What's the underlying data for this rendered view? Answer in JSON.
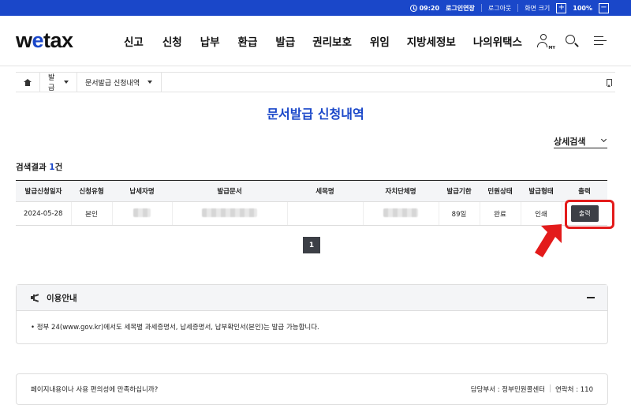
{
  "topbar": {
    "timer": "09:20",
    "extend_label": "로그인연장",
    "logout_label": "로그아웃",
    "screen_size_label": "화면 크기",
    "zoom_in": "+",
    "zoom": "100%",
    "zoom_out": "−"
  },
  "header": {
    "logo_w": "w",
    "logo_e": "e",
    "logo_rest": "tax",
    "nav": [
      "신고",
      "신청",
      "납부",
      "환급",
      "발급",
      "권리보호",
      "위임",
      "지방세정보",
      "나의위택스"
    ],
    "my_badge": "MY"
  },
  "breadcrumb": {
    "level1": "발급",
    "level2": "문서발급 신청내역"
  },
  "page_title": "문서발급 신청내역",
  "detail_search_label": "상세검색",
  "result": {
    "prefix": "검색결과 ",
    "count": "1",
    "suffix": "건"
  },
  "table": {
    "headers": [
      "발급신청일자",
      "신청유형",
      "납세자명",
      "발급문서",
      "세목명",
      "자치단체명",
      "발급기한",
      "민원상태",
      "발급형태",
      "출력"
    ],
    "rows": [
      {
        "date": "2024-05-28",
        "type": "본인",
        "deadline": "89일",
        "status": "완료",
        "form": "인쇄",
        "print_label": "출력"
      }
    ]
  },
  "pagination": {
    "current": "1"
  },
  "guide": {
    "title": "이용안내",
    "text": "• 정부 24(www.gov.kr)에서도 세목별 과세증명서, 납세증명서, 납부확인서(본인)는 발급 가능합니다."
  },
  "footer": {
    "question": "페이지내용이나 사용 편의성에 만족하십니까?",
    "dept": "담당부서 : 정부민원콜센터",
    "contact": "연락처 : 110"
  },
  "colors": {
    "brand_blue": "#1a47c9",
    "highlight_red": "#e31b1b",
    "button_dark": "#3c3f46"
  }
}
